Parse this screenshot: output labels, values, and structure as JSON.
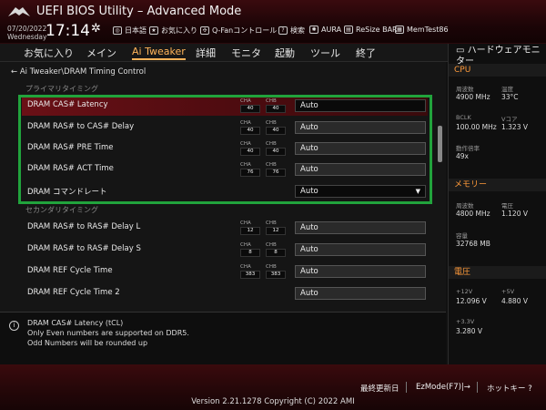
{
  "header": {
    "title": "UEFI BIOS Utility – Advanced Mode",
    "date": "07/20/2022",
    "weekday": "Wednesday",
    "time": "17:14",
    "hotkeys": [
      {
        "label": "日本語",
        "icon": "globe-icon"
      },
      {
        "label": "お気に入り",
        "icon": "star-icon"
      },
      {
        "label": "Q-Fanコントロール",
        "icon": "fan-icon"
      },
      {
        "label": "検索",
        "icon": "question-icon"
      },
      {
        "label": "AURA",
        "icon": "aura-icon"
      },
      {
        "label": "ReSize BAR",
        "icon": "resize-bar-icon"
      },
      {
        "label": "MemTest86",
        "icon": "memtest-icon"
      }
    ]
  },
  "menu": [
    "お気に入り",
    "メイン",
    "Ai Tweaker",
    "詳細",
    "モニタ",
    "起動",
    "ツール",
    "終了"
  ],
  "breadcrumb": "Ai Tweaker\\DRAM Timing Control",
  "sections": {
    "primary": "プライマリタイミング",
    "secondary": "セカンダリタイミング"
  },
  "rows": [
    {
      "label": "DRAM CAS# Latency",
      "cha": "40",
      "chb": "40",
      "value": "Auto"
    },
    {
      "label": "DRAM RAS# to CAS# Delay",
      "cha": "40",
      "chb": "40",
      "value": "Auto"
    },
    {
      "label": "DRAM RAS# PRE Time",
      "cha": "40",
      "chb": "40",
      "value": "Auto"
    },
    {
      "label": "DRAM RAS# ACT Time",
      "cha": "76",
      "chb": "76",
      "value": "Auto"
    },
    {
      "label": "DRAM コマンドレート",
      "value": "Auto"
    },
    {
      "label": "DRAM RAS# to RAS# Delay L",
      "cha": "12",
      "chb": "12",
      "value": "Auto"
    },
    {
      "label": "DRAM RAS# to RAS# Delay S",
      "cha": "8",
      "chb": "8",
      "value": "Auto"
    },
    {
      "label": "DRAM REF Cycle Time",
      "cha": "383",
      "chb": "383",
      "value": "Auto"
    },
    {
      "label": "DRAM REF Cycle Time 2",
      "value": "Auto"
    }
  ],
  "channel_labels": {
    "a": "CHA",
    "b": "CHB"
  },
  "help": {
    "title": "DRAM CAS# Latency (tCL)",
    "line1": "Only Even numbers are supported on DDR5.",
    "line2": "Odd Numbers will be rounded up"
  },
  "hw": {
    "title": "ハードウェアモニター",
    "cpu": {
      "label": "CPU",
      "freq_cap": "周波数",
      "freq": "4900 MHz",
      "temp_cap": "温度",
      "temp": "33°C",
      "bclk_cap": "BCLK",
      "bclk": "100.00 MHz",
      "vcore_cap": "Vコア",
      "vcore": "1.323 V",
      "ratio_cap": "動作倍率",
      "ratio": "49x"
    },
    "memory": {
      "label": "メモリー",
      "freq_cap": "周波数",
      "freq": "4800 MHz",
      "volt_cap": "電圧",
      "volt": "1.120 V",
      "cap_cap": "容量",
      "capacity": "32768 MB"
    },
    "voltage": {
      "label": "電圧",
      "v12_cap": "+12V",
      "v12": "12.096 V",
      "v5_cap": "+5V",
      "v5": "4.880 V",
      "v33_cap": "+3.3V",
      "v33": "3.280 V"
    }
  },
  "footer": {
    "last_modified": "最終更新日",
    "ezmode": "EzMode(F7)|→",
    "hotkey": "ホットキー ?",
    "copyright": "Version 2.21.1278 Copyright (C) 2022 AMI"
  }
}
